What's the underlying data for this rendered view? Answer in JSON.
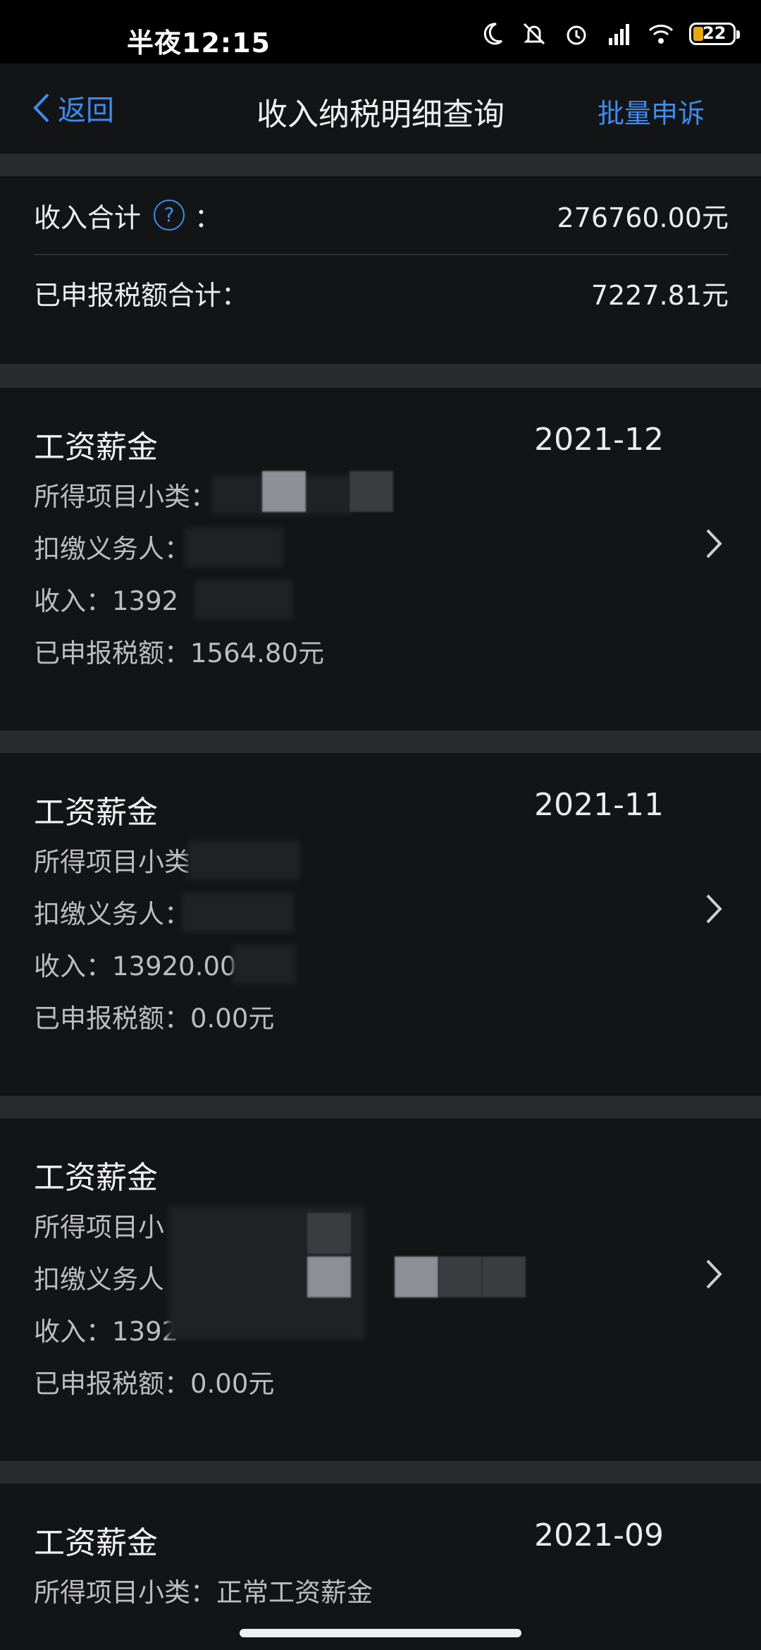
{
  "status_bar": {
    "time": "半夜12:15",
    "battery": "22",
    "icons": [
      "moon-icon",
      "mute-icon",
      "alarm-icon",
      "signal-icon",
      "wifi-icon",
      "battery-icon"
    ]
  },
  "nav": {
    "back_label": "返回",
    "title": "收入纳税明细查询",
    "action_label": "批量申诉"
  },
  "summary": {
    "income_label": "收入合计",
    "income_colon": "：",
    "income_value": "276760.00元",
    "tax_label": "已申报税额合计：",
    "tax_value": "7227.81元"
  },
  "records": [
    {
      "title": "工资薪金",
      "date": "2021-12",
      "subcategory": "所得项目小类：",
      "withholder": "扣缴义务人：",
      "income": "收入：1392",
      "tax": "已申报税额：1564.80元"
    },
    {
      "title": "工资薪金",
      "date": "2021-11",
      "subcategory": "所得项目小类",
      "withholder": "扣缴义务人：",
      "income": "收入：13920.00元",
      "tax": "已申报税额：0.00元"
    },
    {
      "title": "工资薪金",
      "date": "",
      "subcategory": "所得项目小",
      "withholder": "扣缴义务人",
      "income": "收入：1392",
      "tax": "已申报税额：0.00元"
    },
    {
      "title": "工资薪金",
      "date": "2021-09",
      "subcategory": "所得项目小类：正常工资薪金",
      "withholder": "",
      "income": "",
      "tax": ""
    }
  ],
  "colors": {
    "accent": "#3d8cf0",
    "background": "#2a2b2e",
    "card": "#131416",
    "battery": "#e6a817"
  }
}
